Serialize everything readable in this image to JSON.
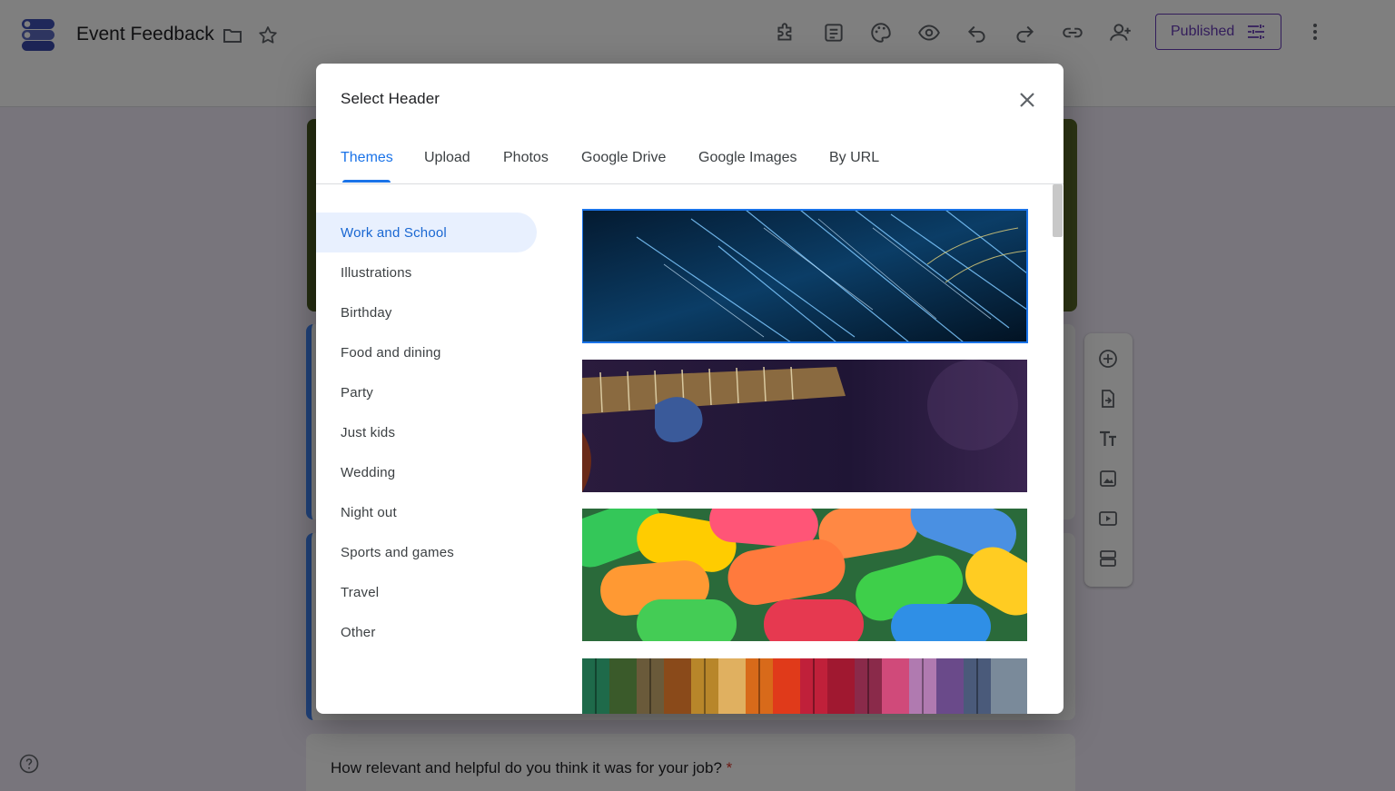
{
  "app": {
    "title": "Event Feedback",
    "publish_label": "Published",
    "toolbar_icons": [
      "addon-icon",
      "responses-icon",
      "palette-icon",
      "preview-icon",
      "undo-icon",
      "redo-icon",
      "link-icon",
      "add-collaborator-icon"
    ]
  },
  "form": {
    "question": "How relevant and helpful do you think it was for your job?",
    "required_marker": "*"
  },
  "modal": {
    "title": "Select Header",
    "tabs": [
      {
        "label": "Themes",
        "active": true
      },
      {
        "label": "Upload",
        "active": false
      },
      {
        "label": "Photos",
        "active": false
      },
      {
        "label": "Google Drive",
        "active": false
      },
      {
        "label": "Google Images",
        "active": false
      },
      {
        "label": "By URL",
        "active": false
      }
    ],
    "categories": [
      {
        "label": "Work and School",
        "active": true
      },
      {
        "label": "Illustrations"
      },
      {
        "label": "Birthday"
      },
      {
        "label": "Food and dining"
      },
      {
        "label": "Party"
      },
      {
        "label": "Just kids"
      },
      {
        "label": "Wedding"
      },
      {
        "label": "Night out"
      },
      {
        "label": "Sports and games"
      },
      {
        "label": "Travel"
      },
      {
        "label": "Other"
      }
    ],
    "images": [
      "fiber-optics",
      "guitar",
      "candy",
      "yarn"
    ]
  },
  "colors": {
    "accent": "#1a73e8",
    "brand": "#673ab7",
    "selected_bg": "#e8f0fe"
  }
}
